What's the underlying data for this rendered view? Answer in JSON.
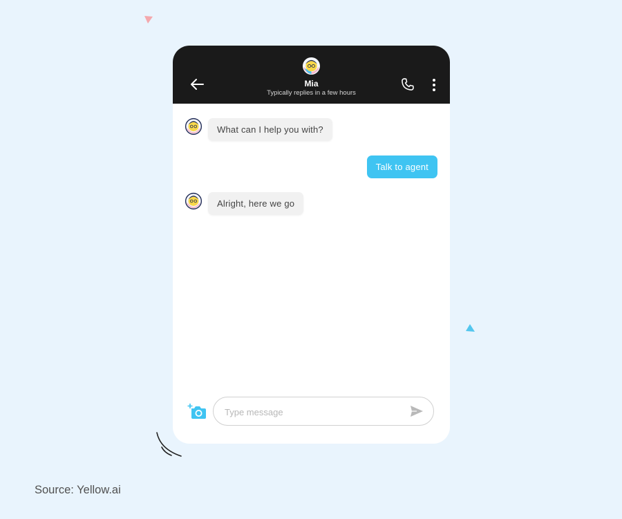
{
  "header": {
    "agent_name": "Mia",
    "agent_status": "Typically replies in a few hours"
  },
  "messages": [
    {
      "from": "bot",
      "text": "What can I help you with?"
    },
    {
      "from": "user",
      "text": "Talk to agent"
    },
    {
      "from": "bot",
      "text": "Alright, here we go"
    }
  ],
  "composer": {
    "placeholder": "Type message"
  },
  "source": "Source: Yellow.ai",
  "colors": {
    "background": "#e9f4fd",
    "topbar": "#1a1a1a",
    "user_bubble": "#3fc4f2",
    "bot_bubble": "#f1f1f1",
    "accent_icon": "#3fc4f2"
  },
  "icons": {
    "back": "arrow-left-icon",
    "call": "phone-icon",
    "menu": "more-vertical-icon",
    "camera": "camera-plus-icon",
    "send": "send-icon"
  }
}
